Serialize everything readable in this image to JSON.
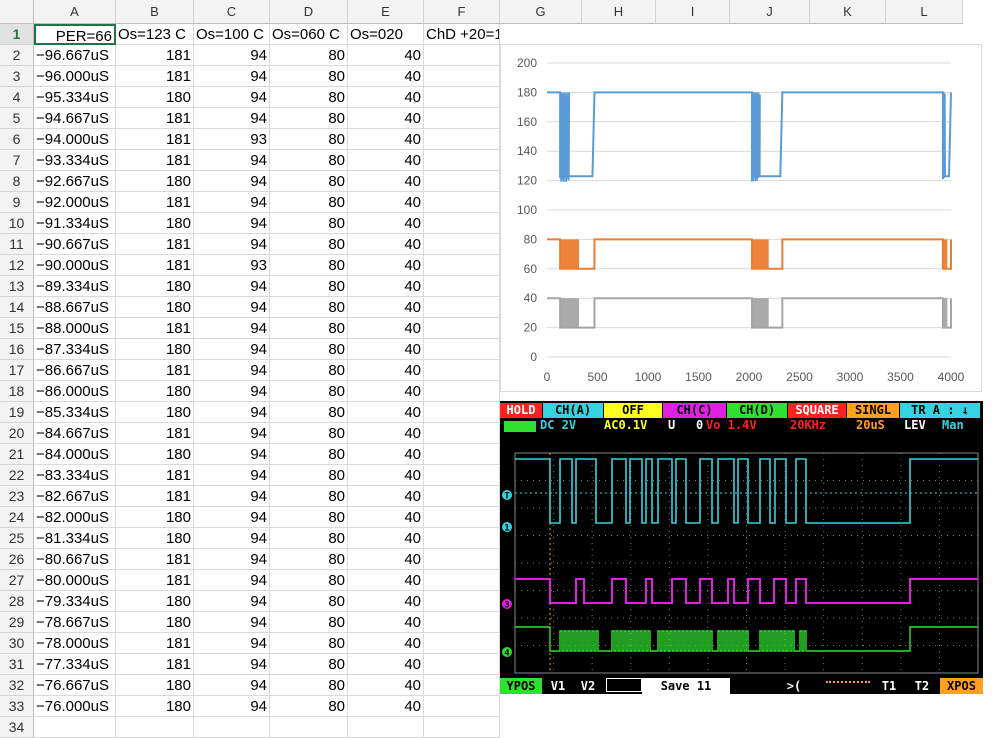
{
  "spreadsheet": {
    "columns": [
      "A",
      "B",
      "C",
      "D",
      "E",
      "F",
      "G",
      "H",
      "I",
      "J",
      "K",
      "L"
    ],
    "header_row": [
      "PER=66",
      "Os=123 C",
      "Os=100 C",
      "Os=060 C",
      "Os=020",
      "ChD +20=1"
    ],
    "rows": [
      [
        "−96.667uS",
        "181",
        "94",
        "80",
        "40"
      ],
      [
        "−96.000uS",
        "181",
        "94",
        "80",
        "40"
      ],
      [
        "−95.334uS",
        "180",
        "94",
        "80",
        "40"
      ],
      [
        "−94.667uS",
        "181",
        "94",
        "80",
        "40"
      ],
      [
        "−94.000uS",
        "181",
        "93",
        "80",
        "40"
      ],
      [
        "−93.334uS",
        "181",
        "94",
        "80",
        "40"
      ],
      [
        "−92.667uS",
        "180",
        "94",
        "80",
        "40"
      ],
      [
        "−92.000uS",
        "181",
        "94",
        "80",
        "40"
      ],
      [
        "−91.334uS",
        "180",
        "94",
        "80",
        "40"
      ],
      [
        "−90.667uS",
        "181",
        "94",
        "80",
        "40"
      ],
      [
        "−90.000uS",
        "181",
        "93",
        "80",
        "40"
      ],
      [
        "−89.334uS",
        "180",
        "94",
        "80",
        "40"
      ],
      [
        "−88.667uS",
        "180",
        "94",
        "80",
        "40"
      ],
      [
        "−88.000uS",
        "181",
        "94",
        "80",
        "40"
      ],
      [
        "−87.334uS",
        "180",
        "94",
        "80",
        "40"
      ],
      [
        "−86.667uS",
        "181",
        "94",
        "80",
        "40"
      ],
      [
        "−86.000uS",
        "180",
        "94",
        "80",
        "40"
      ],
      [
        "−85.334uS",
        "180",
        "94",
        "80",
        "40"
      ],
      [
        "−84.667uS",
        "181",
        "94",
        "80",
        "40"
      ],
      [
        "−84.000uS",
        "180",
        "94",
        "80",
        "40"
      ],
      [
        "−83.334uS",
        "181",
        "94",
        "80",
        "40"
      ],
      [
        "−82.667uS",
        "181",
        "94",
        "80",
        "40"
      ],
      [
        "−82.000uS",
        "180",
        "94",
        "80",
        "40"
      ],
      [
        "−81.334uS",
        "180",
        "94",
        "80",
        "40"
      ],
      [
        "−80.667uS",
        "181",
        "94",
        "80",
        "40"
      ],
      [
        "−80.000uS",
        "181",
        "94",
        "80",
        "40"
      ],
      [
        "−79.334uS",
        "180",
        "94",
        "80",
        "40"
      ],
      [
        "−78.667uS",
        "180",
        "94",
        "80",
        "40"
      ],
      [
        "−78.000uS",
        "181",
        "94",
        "80",
        "40"
      ],
      [
        "−77.334uS",
        "181",
        "94",
        "80",
        "40"
      ],
      [
        "−76.667uS",
        "180",
        "94",
        "80",
        "40"
      ],
      [
        "−76.000uS",
        "180",
        "94",
        "80",
        "40"
      ]
    ]
  },
  "chart_data": {
    "type": "line",
    "xlim": [
      0,
      4000
    ],
    "ylim": [
      0,
      200
    ],
    "x_ticks": [
      0,
      500,
      1000,
      1500,
      2000,
      2500,
      3000,
      3500,
      4000
    ],
    "y_ticks": [
      0,
      20,
      40,
      60,
      80,
      100,
      120,
      140,
      160,
      180,
      200
    ],
    "grid": true,
    "legend": "none",
    "series": [
      {
        "color": "#5b9bd5",
        "high": 180,
        "low": 123,
        "bursts": [
          [
            130,
            470
          ],
          [
            2030,
            2330
          ],
          [
            3920,
            4000
          ]
        ]
      },
      {
        "color": "#ed7d31",
        "high": 80,
        "low": 60,
        "bursts": [
          [
            130,
            470
          ],
          [
            2030,
            2330
          ],
          [
            3920,
            4000
          ]
        ]
      },
      {
        "color": "#a5a5a5",
        "high": 40,
        "low": 20,
        "bursts": [
          [
            130,
            470
          ],
          [
            2030,
            2330
          ],
          [
            3920,
            4000
          ]
        ]
      }
    ]
  },
  "scope": {
    "status_buttons": [
      "HOLD",
      "CH(A)",
      "OFF",
      "CH(C)",
      "CH(D)",
      "SQUARE",
      "SINGL",
      "TR A : ↓"
    ],
    "status_line": {
      "ch_a": "DC 2V",
      "ch_b": "AC0.1V",
      "u": "U",
      "zero": "0",
      "vo": "Vo 1.4V",
      "freq": "20KHz",
      "time": "20uS",
      "lev": "LEV",
      "mode": "Man"
    },
    "channel_markers": [
      "T",
      "1",
      "3",
      "4"
    ],
    "bottom_buttons": [
      "YPOS",
      "V1",
      "V2",
      "Save 11",
      ">(",
      "T1",
      "T2",
      "XPOS"
    ],
    "colors": {
      "ch1": "#35d3e0",
      "ch3": "#e020e0",
      "ch4": "#30e030",
      "hold": "#ff2020"
    }
  }
}
